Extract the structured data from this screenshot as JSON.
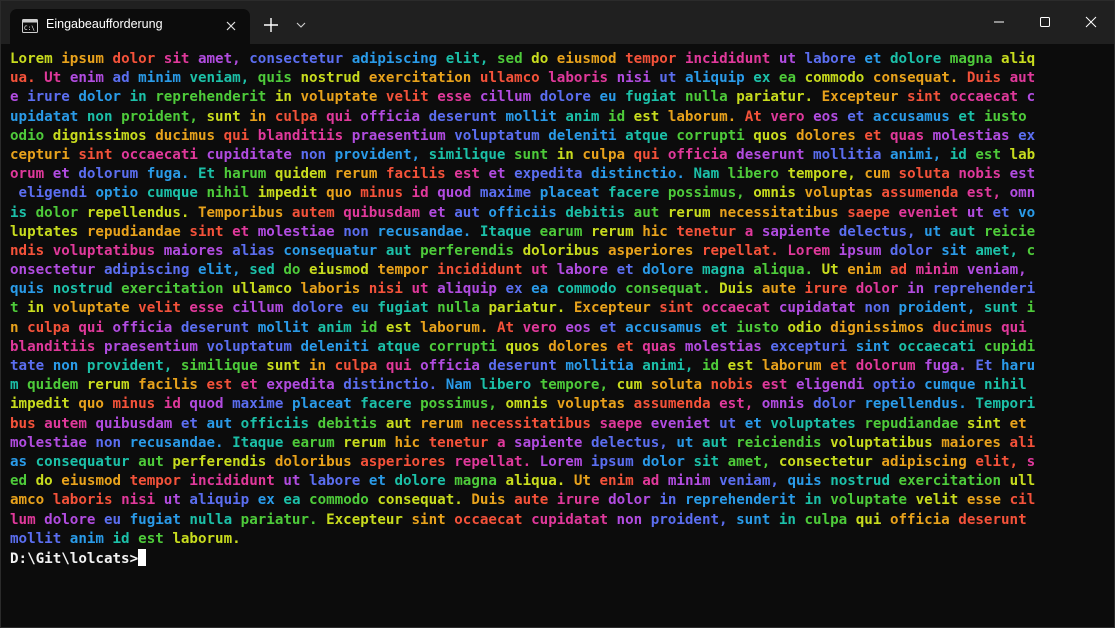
{
  "window": {
    "tab_title": "Eingabeaufforderung",
    "tab_icon": "cmd-terminal-icon",
    "new_tab_icon": "plus-icon",
    "dropdown_icon": "chevron-down-icon",
    "minimize_icon": "minimize-icon",
    "maximize_icon": "maximize-icon",
    "close_icon": "close-icon",
    "title_bar_color": "#202020",
    "background_color": "#0c0c0c"
  },
  "palette": [
    "#c8dc1e",
    "#e8a21c",
    "#f4523a",
    "#e0399b",
    "#b14ce0",
    "#5b6ef0",
    "#2a9be8",
    "#1cc0a8",
    "#4ecb3a"
  ],
  "terminal": {
    "output_lines": [
      "Lorem ipsum dolor sit amet, consectetur adipiscing elit, sed do eiusmod tempor incididunt ut labore et dolore magna aliq",
      "ua. Ut enim ad minim veniam, quis nostrud exercitation ullamco laboris nisi ut aliquip ex ea commodo consequat. Duis aut",
      "e irure dolor in reprehenderit in voluptate velit esse cillum dolore eu fugiat nulla pariatur. Excepteur sint occaecat c",
      "upidatat non proident, sunt in culpa qui officia deserunt mollit anim id est laborum. At vero eos et accusamus et iusto ",
      "odio dignissimos ducimus qui blanditiis praesentium voluptatum deleniti atque corrupti quos dolores et quas molestias ex",
      "cepturi sint occaecati cupiditate non provident, similique sunt in culpa qui officia deserunt mollitia animi, id est lab",
      "orum et dolorum fuga. Et harum quidem rerum facilis est et expedita distinctio. Nam libero tempore, cum soluta nobis est",
      " eligendi optio cumque nihil impedit quo minus id quod maxime placeat facere possimus, omnis voluptas assumenda est, omn",
      "is dolor repellendus. Temporibus autem quibusdam et aut officiis debitis aut rerum necessitatibus saepe eveniet ut et vo",
      "luptates repudiandae sint et molestiae non recusandae. Itaque earum rerum hic tenetur a sapiente delectus, ut aut reicie",
      "ndis voluptatibus maiores alias consequatur aut perferendis doloribus asperiores repellat. Lorem ipsum dolor sit amet, c",
      "onsectetur adipiscing elit, sed do eiusmod tempor incididunt ut labore et dolore magna aliqua. Ut enim ad minim veniam, ",
      "quis nostrud exercitation ullamco laboris nisi ut aliquip ex ea commodo consequat. Duis aute irure dolor in reprehenderi",
      "t in voluptate velit esse cillum dolore eu fugiat nulla pariatur. Excepteur sint occaecat cupidatat non proident, sunt i",
      "n culpa qui officia deserunt mollit anim id est laborum. At vero eos et accusamus et iusto odio dignissimos ducimus qui ",
      "blanditiis praesentium voluptatum deleniti atque corrupti quos dolores et quas molestias excepturi sint occaecati cupidi",
      "tate non provident, similique sunt in culpa qui officia deserunt mollitia animi, id est laborum et dolorum fuga. Et haru",
      "m quidem rerum facilis est et expedita distinctio. Nam libero tempore, cum soluta nobis est eligendi optio cumque nihil ",
      "impedit quo minus id quod maxime placeat facere possimus, omnis voluptas assumenda est, omnis dolor repellendus. Tempori",
      "bus autem quibusdam et aut officiis debitis aut rerum necessitatibus saepe eveniet ut et voluptates repudiandae sint et ",
      "molestiae non recusandae. Itaque earum rerum hic tenetur a sapiente delectus, ut aut reiciendis voluptatibus maiores ali",
      "as consequatur aut perferendis doloribus asperiores repellat. Lorem ipsum dolor sit amet, consectetur adipiscing elit, s",
      "ed do eiusmod tempor incididunt ut labore et dolore magna aliqua. Ut enim ad minim veniam, quis nostrud exercitation ull",
      "amco laboris nisi ut aliquip ex ea commodo consequat. Duis aute irure dolor in reprehenderit in voluptate velit esse cil",
      "lum dolore eu fugiat nulla pariatur. Excepteur sint occaecat cupidatat non proident, sunt in culpa qui officia deserunt ",
      "mollit anim id est laborum."
    ],
    "prompt": "D:\\Git\\lolcats>"
  }
}
